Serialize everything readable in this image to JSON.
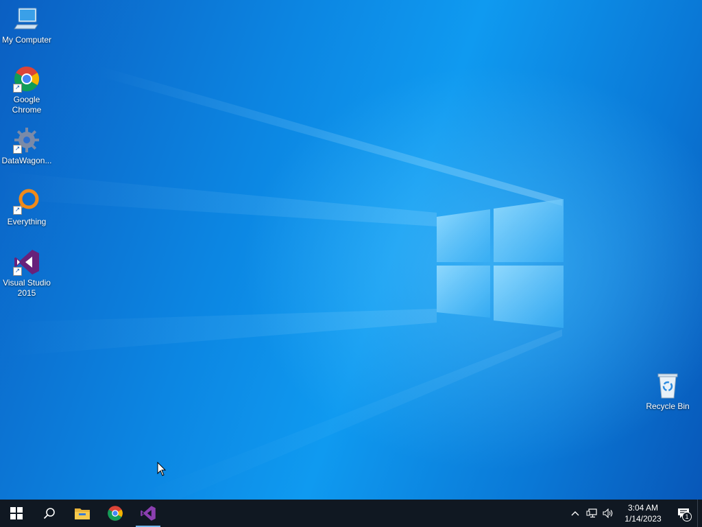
{
  "desktop": {
    "icons": [
      {
        "id": "my-computer",
        "label": "My Computer",
        "icon": "computer-icon",
        "shortcut": false
      },
      {
        "id": "google-chrome",
        "label": "Google Chrome",
        "icon": "chrome-icon",
        "shortcut": true
      },
      {
        "id": "datawagon",
        "label": "DataWagon...",
        "icon": "gear-icon",
        "shortcut": true
      },
      {
        "id": "everything",
        "label": "Everything",
        "icon": "magnifier-icon",
        "shortcut": true
      },
      {
        "id": "visual-studio-2015",
        "label": "Visual Studio 2015",
        "icon": "visual-studio-icon",
        "shortcut": true
      },
      {
        "id": "recycle-bin",
        "label": "Recycle Bin",
        "icon": "recycle-bin-icon",
        "shortcut": false
      }
    ]
  },
  "taskbar": {
    "pinned": [
      {
        "name": "start",
        "icon": "windows-logo-icon"
      },
      {
        "name": "search",
        "icon": "search-icon"
      },
      {
        "name": "file-explorer",
        "icon": "folder-icon"
      },
      {
        "name": "chrome",
        "icon": "chrome-icon"
      },
      {
        "name": "visual-studio",
        "icon": "visual-studio-icon"
      }
    ],
    "tray": {
      "icons": [
        "chevron-up-icon",
        "network-icon",
        "volume-icon"
      ],
      "time": "3:04 AM",
      "date": "1/14/2023",
      "notification_count": "1"
    }
  },
  "colors": {
    "taskbar_bg": "#101822",
    "desktop_accent": "#0a7fd8",
    "active_indicator": "#76b9ed"
  }
}
